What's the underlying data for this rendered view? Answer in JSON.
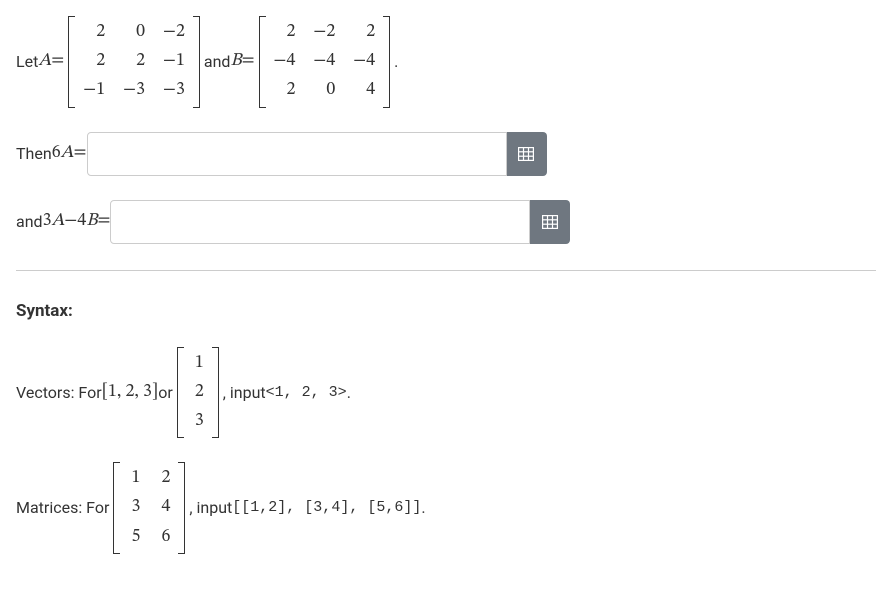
{
  "problem": {
    "let_text": "Let ",
    "var_A": "A",
    "equals": " = ",
    "and_text": " and ",
    "var_B": "B",
    "period": " .",
    "matrix_A": [
      "2",
      "0",
      "−2",
      "2",
      "2",
      "−1",
      "−1",
      "−3",
      "−3"
    ],
    "matrix_B": [
      "2",
      "−2",
      "2",
      "−4",
      "−4",
      "−4",
      "2",
      "0",
      "4"
    ]
  },
  "q1": {
    "label_then": "Then ",
    "expr_coeff": "6",
    "expr_var": "A",
    "expr_eq": " = "
  },
  "q2": {
    "label_and": "and ",
    "expr_a_coeff": "3",
    "expr_a_var": "A",
    "expr_minus": " − ",
    "expr_b_coeff": "4",
    "expr_b_var": "B",
    "expr_eq": " = "
  },
  "syntax": {
    "heading": "Syntax:",
    "vectors_prefix": "Vectors: For ",
    "vector_row": "[1, 2, 3]",
    "or_text": " or ",
    "vector_col": [
      "1",
      "2",
      "3"
    ],
    "vectors_input_pre": " , input ",
    "vectors_code": "<1, 2, 3>",
    "vectors_period": ".",
    "matrices_prefix": "Matrices: For ",
    "matrix_example": [
      "1",
      "2",
      "3",
      "4",
      "5",
      "6"
    ],
    "matrices_input_pre": " , input ",
    "matrices_code": "[[1,2], [3,4], [5,6]]",
    "matrices_period": "."
  }
}
